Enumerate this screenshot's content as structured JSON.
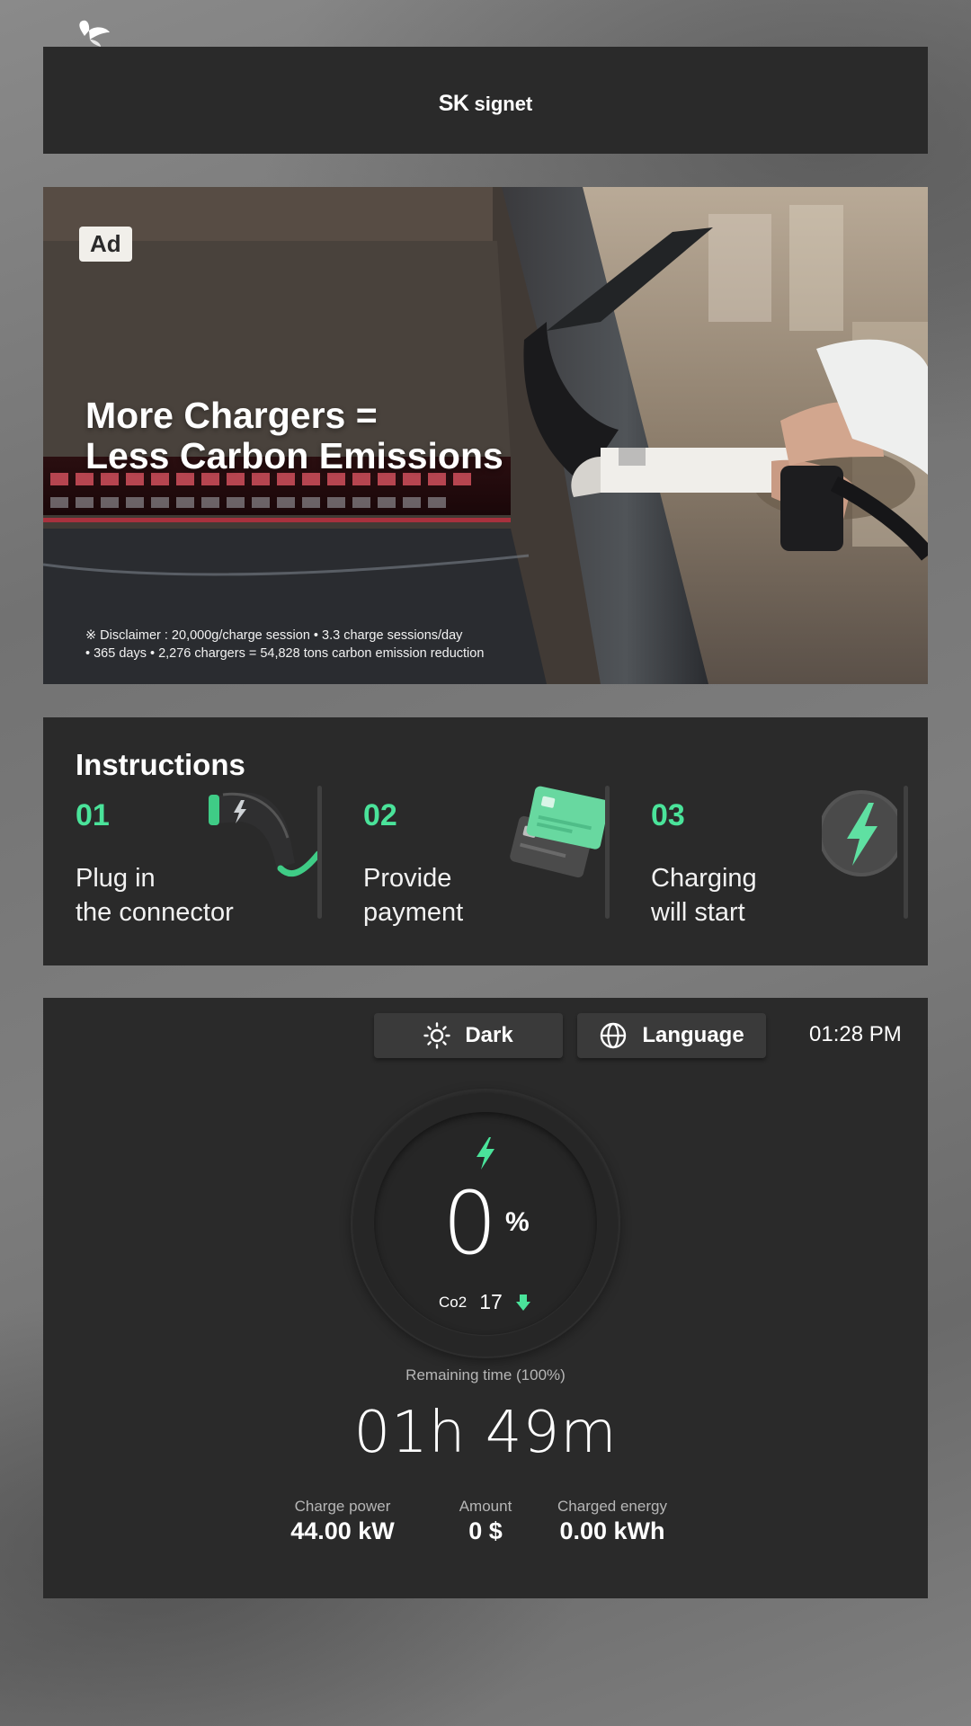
{
  "header": {
    "brand_sk": "SK",
    "brand_signet": "signet"
  },
  "ad": {
    "badge": "Ad",
    "headline_line1": "More Chargers =",
    "headline_line2": "Less Carbon Emissions",
    "disclaimer_line1": "※ Disclaimer : 20,000g/charge session • 3.3 charge sessions/day",
    "disclaimer_line2": "• 365 days • 2,276 chargers = 54,828 tons carbon emission reduction"
  },
  "instructions": {
    "title": "Instructions",
    "steps": [
      {
        "number": "01",
        "line1": "Plug in",
        "line2": "the connector",
        "icon": "connector-icon"
      },
      {
        "number": "02",
        "line1": "Provide",
        "line2": "payment",
        "icon": "payment-cards-icon"
      },
      {
        "number": "03",
        "line1": "Charging",
        "line2": "will start",
        "icon": "bolt-icon"
      }
    ]
  },
  "charging": {
    "theme_button": "Dark",
    "language_button": "Language",
    "time": "01:28 PM",
    "percent": "0",
    "percent_unit": "%",
    "co2_label": "Co2",
    "co2_value": "17",
    "remaining_label": "Remaining time (100%)",
    "remaining_time": "01h 49m",
    "stats": [
      {
        "label": "Charge power",
        "value": "44.00 kW"
      },
      {
        "label": "Amount",
        "value": "0 $"
      },
      {
        "label": "Charged energy",
        "value": "0.00 kWh"
      }
    ]
  },
  "colors": {
    "accent": "#4ae39a",
    "panel": "#2a2a2a",
    "button": "#3a3a3a"
  }
}
